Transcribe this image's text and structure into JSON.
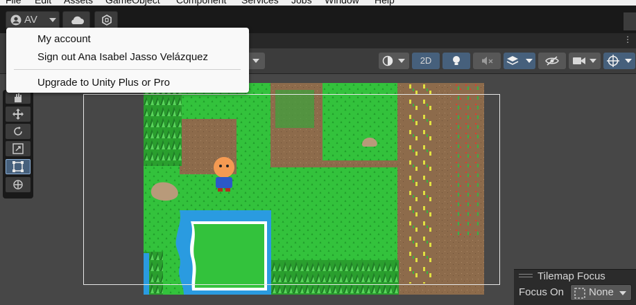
{
  "menubar": {
    "items": [
      "File",
      "Edit",
      "Assets",
      "GameObject",
      "Component",
      "Services",
      "Jobs",
      "Window",
      "Help"
    ]
  },
  "toolbar": {
    "account_initials": "AV"
  },
  "account_menu": {
    "items": [
      "My account",
      "Sign out Ana Isabel Jasso Velázquez",
      "Upgrade to Unity Plus or Pro"
    ]
  },
  "scene_toolbar": {
    "mode_2d": "2D"
  },
  "tilemap_focus": {
    "title": "Tilemap Focus",
    "focus_on_label": "Focus On",
    "focus_on_value": "None"
  },
  "colors": {
    "accent": "#46607c",
    "grass": "#2fbf3a",
    "dirt": "#8a6a4a",
    "water": "#2a9be0"
  }
}
